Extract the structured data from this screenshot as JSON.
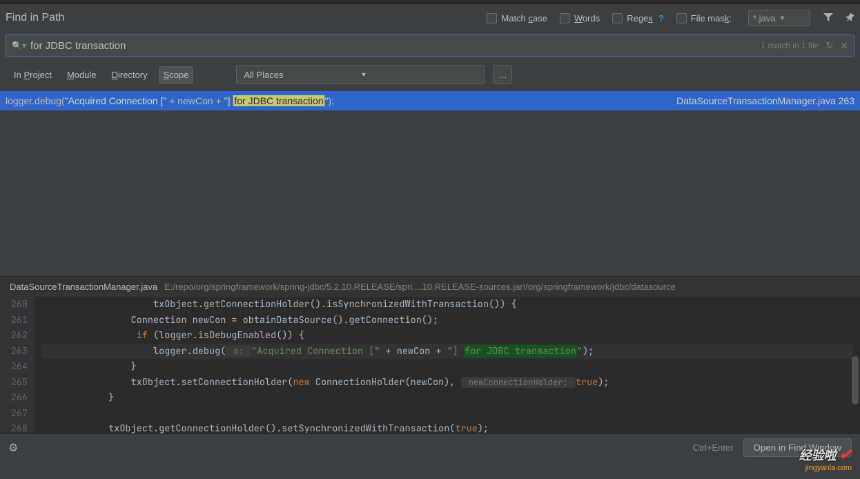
{
  "title": "Find in Path",
  "options": {
    "match_case": "Match case",
    "words": "Words",
    "regex": "Regex",
    "regex_help": "?",
    "file_mask": "File mask:",
    "file_mask_value": "*.java"
  },
  "search": {
    "value": "for JDBC transaction",
    "match_info": "1 match in 1 file"
  },
  "scope_tabs": {
    "project": "In Project",
    "module": "Module",
    "directory": "Directory",
    "scope": "Scope"
  },
  "places_combo": "All Places",
  "more_btn": "...",
  "result": {
    "prefix": "logger.debug(",
    "str1": "\"Acquired Connection [\"",
    "mid1": " + newCon + ",
    "str2_open": "\"] ",
    "highlight": "for JDBC transaction",
    "str2_close": "\"",
    "suffix": ");",
    "file": "DataSourceTransactionManager.java",
    "line": "263"
  },
  "preview": {
    "file": "DataSourceTransactionManager.java",
    "path": "E:/repo/org/springframework/spring-jdbc/5.2.10.RELEASE/spri....10.RELEASE-sources.jar!/org/springframework/jdbc/datasource"
  },
  "code": {
    "gutter": [
      "260",
      "261",
      "262",
      "263",
      "264",
      "265",
      "266",
      "267",
      "268"
    ],
    "l260_a": "                    txObject.getConnectionHolder().isSynchronizedWithTransaction()) {",
    "l261_a": "                Connection newCon = obtainDataSource().getConnection();",
    "l262_a": "                if",
    "l262_b": " (logger.isDebugEnabled()) {",
    "l263_a": "                    logger.debug(",
    "l263_hint": " o: ",
    "l263_b": "\"Acquired Connection [\"",
    "l263_c": " + newCon + ",
    "l263_d": "\"] ",
    "l263_hl": "for JDBC transaction",
    "l263_e": "\"",
    "l263_f": ");",
    "l264_a": "                }",
    "l265_a": "                txObject.setConnectionHolder(",
    "l265_b": "new",
    "l265_c": " ConnectionHolder(newCon), ",
    "l265_hint": " newConnectionHolder: ",
    "l265_d": "true",
    "l265_e": ");",
    "l266_a": "            }",
    "l267_a": "",
    "l268_a": "            txObject.getConnectionHolder().setSynchronizedWithTransaction(",
    "l268_b": "true",
    "l268_c": ");"
  },
  "bottom": {
    "shortcut": "Ctrl+Enter",
    "open_btn": "Open in Find Window"
  },
  "watermark": {
    "text": "经验啦",
    "suffix": "✔",
    "domain": "jingyanla.com"
  }
}
